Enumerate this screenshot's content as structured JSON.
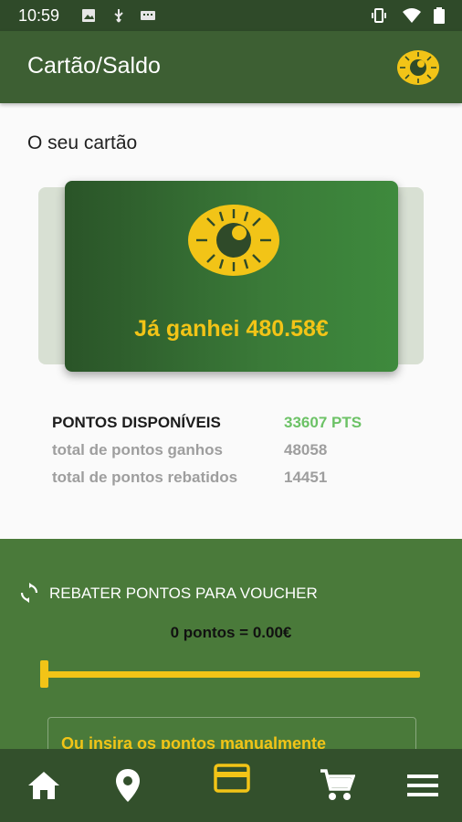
{
  "status_bar": {
    "time": "10:59"
  },
  "app_bar": {
    "title": "Cartão/Saldo"
  },
  "section_label": "O seu cartão",
  "card": {
    "earned_text": "Já ganhei 480.58€"
  },
  "points": {
    "available_label": "PONTOS DISPONÍVEIS",
    "available_value": "33607 PTS",
    "earned_total_label": "total de pontos ganhos",
    "earned_total_value": "48058",
    "redeemed_total_label": "total de pontos rebatidos",
    "redeemed_total_value": "14451"
  },
  "redeem": {
    "title": "REBATER PONTOS PARA VOUCHER",
    "conversion": "0 pontos = 0.00€",
    "slider_value": 0,
    "manual_prompt": "Ou insira os pontos manualmente"
  },
  "nav": [
    "home-icon",
    "location-icon",
    "card-icon",
    "cart-icon",
    "menu-icon"
  ],
  "colors": {
    "primary_dark": "#2f4a29",
    "primary": "#3d5f33",
    "accent_yellow": "#f2c417",
    "points_green": "#6cc266"
  }
}
